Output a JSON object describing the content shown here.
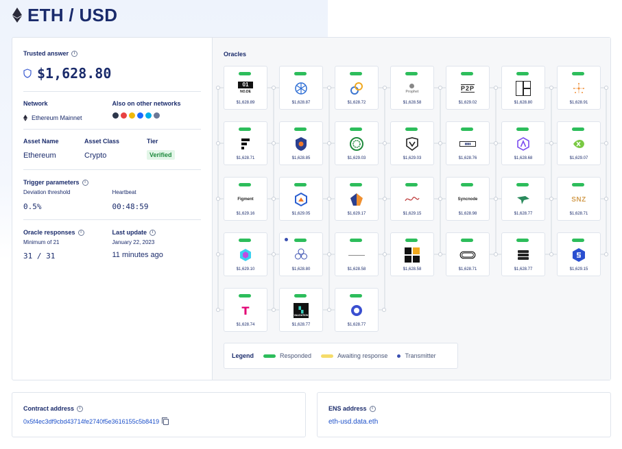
{
  "header": {
    "title": "ETH / USD"
  },
  "trusted": {
    "label": "Trusted answer",
    "value": "$1,628.80"
  },
  "network": {
    "label": "Network",
    "value": "Ethereum Mainnet",
    "other_label": "Also on other networks",
    "other_icons": [
      {
        "name": "arbitrum-icon",
        "color": "#2d374b"
      },
      {
        "name": "avalanche-icon",
        "color": "#e84142"
      },
      {
        "name": "bnb-icon",
        "color": "#f0b90b"
      },
      {
        "name": "fantom-icon",
        "color": "#1969ff"
      },
      {
        "name": "harmony-icon",
        "color": "#00aee9"
      },
      {
        "name": "more-icon",
        "color": "#6b7896"
      }
    ]
  },
  "asset": {
    "name_label": "Asset Name",
    "name_value": "Ethereum",
    "class_label": "Asset Class",
    "class_value": "Crypto",
    "tier_label": "Tier",
    "tier_value": "Verified"
  },
  "trigger": {
    "label": "Trigger parameters",
    "deviation_label": "Deviation threshold",
    "deviation_value": "0.5%",
    "heartbeat_label": "Heartbeat",
    "heartbeat_value": "00:48:59"
  },
  "responses": {
    "label": "Oracle responses",
    "min_label": "Minimum of 21",
    "value": "31 / 31",
    "update_label": "Last update",
    "update_date": "January 22, 2023",
    "update_value": "11 minutes ago"
  },
  "oracles": {
    "title": "Oracles",
    "items": [
      {
        "logo": "01 NODE",
        "price": "$1,628.89",
        "status": "responded",
        "style": "node"
      },
      {
        "logo": "",
        "price": "$1,628.87",
        "status": "responded",
        "style": "net"
      },
      {
        "logo": "",
        "price": "$1,628.72",
        "status": "responded",
        "style": "chain"
      },
      {
        "logo": "Prophet",
        "price": "$1,628.58",
        "status": "responded",
        "style": "prophet"
      },
      {
        "logo": "P2P",
        "price": "$1,629.02",
        "status": "responded",
        "style": "p2p"
      },
      {
        "logo": "",
        "price": "$1,628.80",
        "status": "responded",
        "style": "window"
      },
      {
        "logo": "",
        "price": "$1,628.91",
        "status": "responded",
        "style": "spark"
      },
      {
        "logo": "",
        "price": "$1,628.71",
        "status": "responded",
        "style": "fig"
      },
      {
        "logo": "",
        "price": "$1,628.85",
        "status": "responded",
        "style": "shield"
      },
      {
        "logo": "",
        "price": "$1,629.03",
        "status": "responded",
        "style": "globe"
      },
      {
        "logo": "",
        "price": "$1,629.03",
        "status": "responded",
        "style": "vee"
      },
      {
        "logo": "",
        "price": "$1,628.76",
        "status": "responded",
        "style": "box"
      },
      {
        "logo": "",
        "price": "$1,628.68",
        "status": "responded",
        "style": "alpha"
      },
      {
        "logo": "",
        "price": "$1,629.07",
        "status": "responded",
        "style": "xleaf"
      },
      {
        "logo": "Figment",
        "price": "$1,629.16",
        "status": "responded",
        "style": "text"
      },
      {
        "logo": "",
        "price": "$1,629.05",
        "status": "responded",
        "style": "hexa"
      },
      {
        "logo": "",
        "price": "$1,629.17",
        "status": "responded",
        "style": "pent"
      },
      {
        "logo": "",
        "price": "$1,629.15",
        "status": "responded",
        "style": "wave"
      },
      {
        "logo": "Syncnode",
        "price": "$1,628.98",
        "status": "responded",
        "style": "text"
      },
      {
        "logo": "",
        "price": "$1,628.77",
        "status": "responded",
        "style": "bird"
      },
      {
        "logo": "SNZ",
        "price": "$1,628.71",
        "status": "responded",
        "style": "snz"
      },
      {
        "logo": "",
        "price": "$1,629.10",
        "status": "responded",
        "style": "cube"
      },
      {
        "logo": "",
        "price": "$1,628.80",
        "status": "responded",
        "style": "flower",
        "transmitter": true
      },
      {
        "logo": "",
        "price": "$1,628.58",
        "status": "responded",
        "style": "line"
      },
      {
        "logo": "",
        "price": "$1,628.58",
        "status": "responded",
        "style": "quad"
      },
      {
        "logo": "",
        "price": "$1,628.71",
        "status": "responded",
        "style": "track"
      },
      {
        "logo": "",
        "price": "$1,628.77",
        "status": "responded",
        "style": "stack"
      },
      {
        "logo": "",
        "price": "$1,629.15",
        "status": "responded",
        "style": "sblue"
      },
      {
        "logo": "T",
        "price": "$1,628.74",
        "status": "responded",
        "style": "tmob"
      },
      {
        "logo": "VALIDATION",
        "price": "$1,628.77",
        "status": "responded",
        "style": "valid"
      },
      {
        "logo": "",
        "price": "$1,628.77",
        "status": "responded",
        "style": "ring"
      }
    ]
  },
  "legend": {
    "title": "Legend",
    "responded": "Responded",
    "awaiting": "Awaiting response",
    "transmitter": "Transmitter",
    "colors": {
      "responded": "#2dbd5b",
      "awaiting": "#f5dc6a",
      "transmitter": "#3a4fb0"
    }
  },
  "contract": {
    "label": "Contract address",
    "value": "0x5f4ec3df9cbd43714fe2740f5e3616155c5b8419"
  },
  "ens": {
    "label": "ENS address",
    "value": "eth-usd.data.eth"
  }
}
